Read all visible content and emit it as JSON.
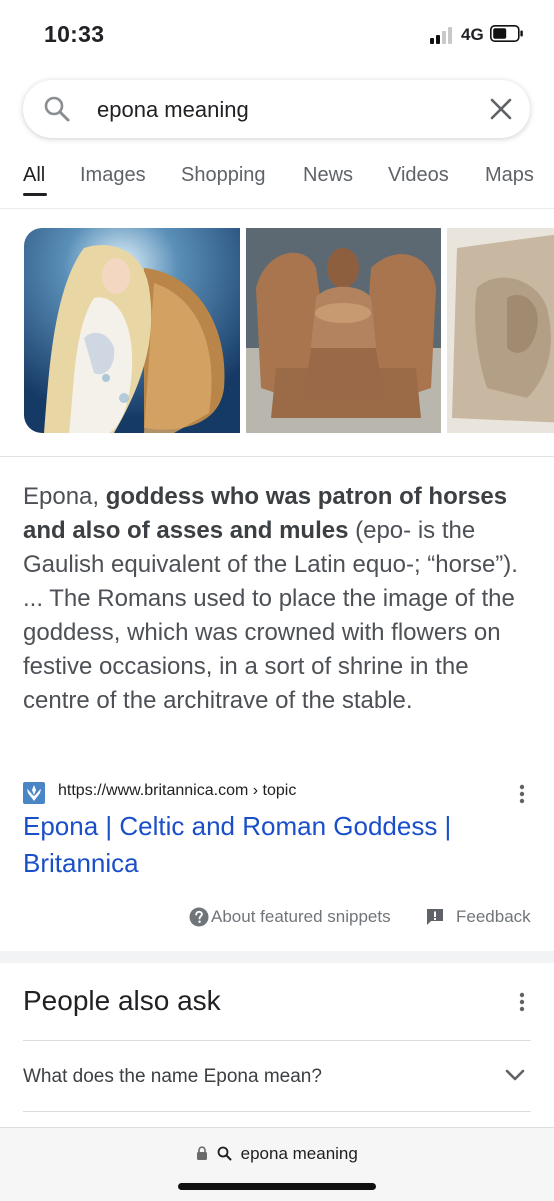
{
  "status_bar": {
    "time": "10:33",
    "network": "4G"
  },
  "search": {
    "query": "epona meaning",
    "icon": "search-icon",
    "clear_icon": "close-icon"
  },
  "tabs": [
    {
      "label": "All",
      "active": true
    },
    {
      "label": "Images"
    },
    {
      "label": "Shopping"
    },
    {
      "label": "News"
    },
    {
      "label": "Videos"
    },
    {
      "label": "Maps"
    }
  ],
  "featured_snippet": {
    "lead": "Epona, ",
    "bold": "goddess who was patron of horses and also of asses and mules",
    "rest": " (epo- is the Gaulish equivalent of the Latin equo-; “horse”). ... The Romans used to place the image of the goddess, which was crowned with flowers on festive occasions, in a sort of shrine in the centre of the architrave of the stable.",
    "source_url": "https://www.britannica.com › topic",
    "title": "Epona | Celtic and Roman Goddess | Britannica",
    "about_label": "About featured snippets",
    "feedback_label": "Feedback"
  },
  "people_also_ask": {
    "title": "People also ask",
    "questions": [
      "What does the name Epona mean?"
    ]
  },
  "bottom_bar": {
    "address": "epona meaning"
  },
  "colors": {
    "link": "#1a4fc9",
    "text": "#202124",
    "muted": "#70757a"
  }
}
